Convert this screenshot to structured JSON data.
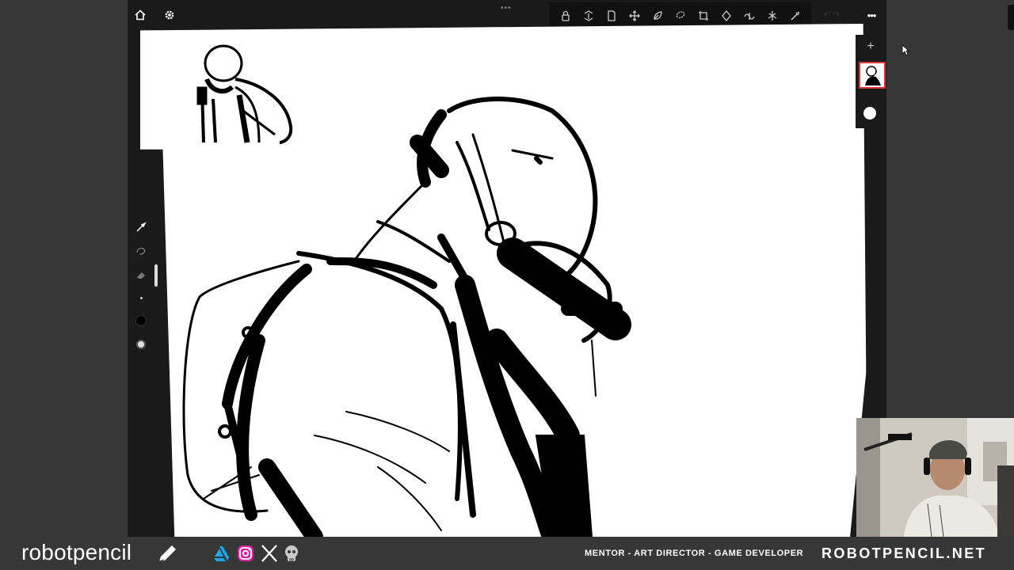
{
  "app": {
    "grip_label": "•••",
    "toolbar_tools": [
      "lock-icon",
      "transform-icon",
      "document-icon",
      "move-icon",
      "symmetry-icon",
      "lasso-select-icon",
      "crop-icon",
      "fill-icon",
      "stabilizer-icon",
      "perspective-icon",
      "color-pick-icon"
    ],
    "more_label": "•••",
    "add_layer_label": "+"
  },
  "footer": {
    "brand": "robotpencil",
    "social_icons": [
      "artstation-icon",
      "instagram-icon",
      "x-icon",
      "skull-icon"
    ],
    "tagline": "MENTOR - ART DIRECTOR - GAME DEVELOPER",
    "website": "ROBOTPENCIL.NET"
  },
  "colors": {
    "app_bg": "#1a1a1a",
    "outer_bg": "#373737",
    "layer_selected_border": "#dd3333",
    "canvas": "#ffffff"
  }
}
